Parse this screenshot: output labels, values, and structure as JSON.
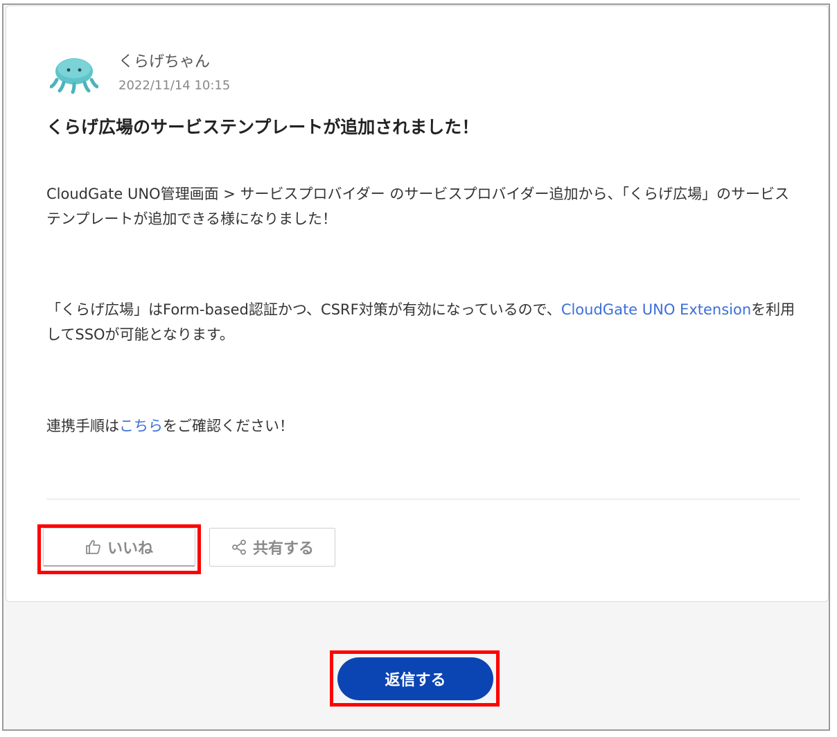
{
  "post": {
    "author": "くらげちゃん",
    "timestamp": "2022/11/14 10:15",
    "title": "くらげ広場のサービステンプレートが追加されました！",
    "para1": "CloudGate UNO管理画面 > サービスプロバイダー のサービスプロバイダー追加から、「くらげ広場」のサービステンプレートが追加できる様になりました！",
    "para2_before": "「くらげ広場」はForm-based認証かつ、CSRF対策が有効になっているので、",
    "para2_link": "CloudGate UNO Extension",
    "para2_after": "を利用してSSOが可能となります。",
    "para3_before": "連携手順は",
    "para3_link": "こちら",
    "para3_after": "をご確認ください！"
  },
  "actions": {
    "like_label": "いいね",
    "share_label": "共有する",
    "reply_label": "返信する"
  },
  "colors": {
    "link": "#3b6fd8",
    "reply_button": "#0b45b3",
    "highlight": "#ff0000"
  }
}
